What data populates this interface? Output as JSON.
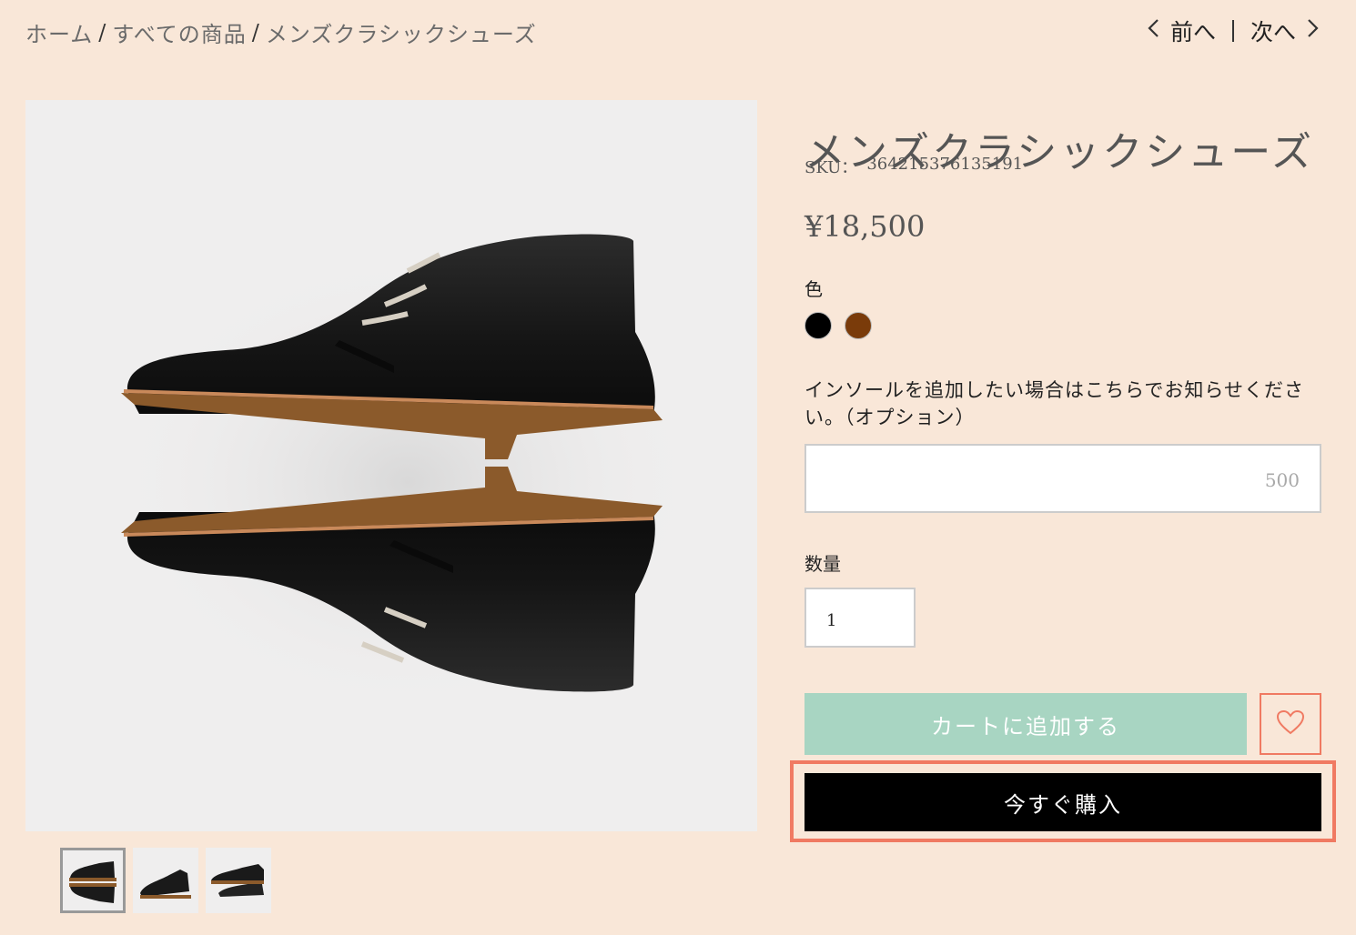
{
  "breadcrumb": {
    "home": "ホーム",
    "separator": "/",
    "all_products": "すべての商品",
    "current": "メンズクラシックシューズ"
  },
  "pager": {
    "prev": "前へ",
    "next": "次へ",
    "prev_icon": "chevron-left-icon",
    "next_icon": "chevron-right-icon"
  },
  "product": {
    "title": "メンズクラシックシューズ",
    "sku_label": "SKU：",
    "sku_value": "364215376135191",
    "price": "¥18,500",
    "image_subject": "black leather chukka boots",
    "thumbnails": 3,
    "active_thumbnail": 1
  },
  "options": {
    "color_label": "色",
    "colors": [
      "#000000",
      "#7a3b0a"
    ],
    "insole_label": "インソールを追加したい場合はこちらでお知らせください。（オプション）",
    "insole_char_limit": "500",
    "insole_value": ""
  },
  "quantity": {
    "label": "数量",
    "value": "1"
  },
  "actions": {
    "add_to_cart": "カートに追加する",
    "wishlist_icon": "heart-icon",
    "buy_now": "今すぐ購入"
  },
  "colors": {
    "background": "#f9e7d8",
    "add_to_cart_bg": "#a8d5c2",
    "buy_now_bg": "#000000",
    "accent": "#f07a62"
  }
}
